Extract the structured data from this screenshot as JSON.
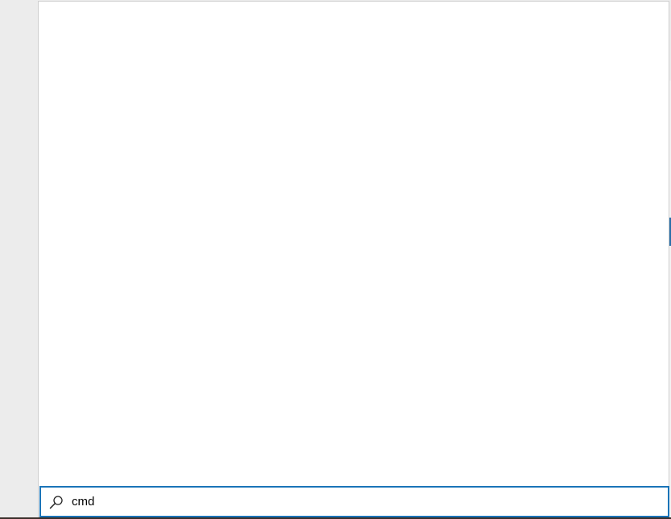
{
  "search": {
    "query": "cmd",
    "icon": "search-icon"
  },
  "colors": {
    "accent": "#1a74b8",
    "panel_bg": "#ffffff",
    "desktop_bg": "#ececec"
  }
}
